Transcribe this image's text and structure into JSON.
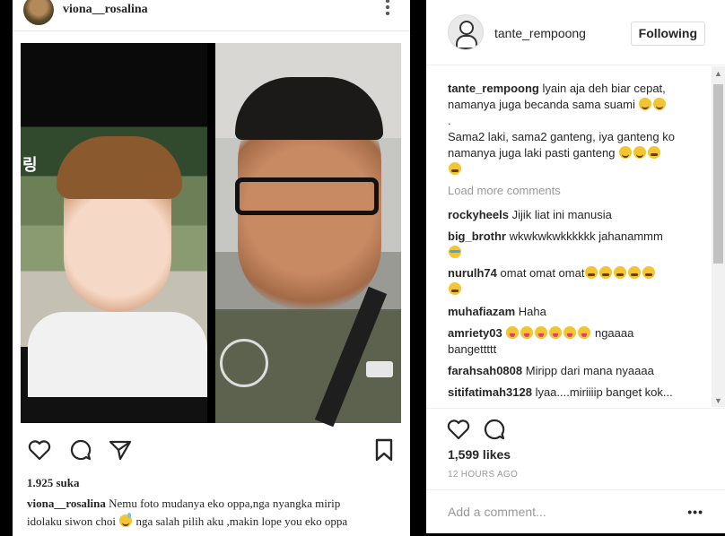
{
  "left_post": {
    "username": "viona__rosalina",
    "kebab": "⋮",
    "photo_sign_text": "링",
    "likes": "1.925 suka",
    "caption_user": "viona__rosalina",
    "caption_text_1": "Nemu foto mudanya eko oppa,nga nyangka mirip",
    "caption_text_2": "idolaku siwon choi",
    "caption_text_3": "nga salah pilih aku ,makin lope you eko oppa"
  },
  "right_panel": {
    "username": "tante_rempoong",
    "following_label": "Following",
    "comment_main_user": "tante_rempoong",
    "comment_main_text_1": "lyain aja deh biar cepat,",
    "comment_main_text_2": "namanya juga becanda sama suami",
    "comment_main_dot": ".",
    "comment_main_text_3": "Sama2 laki, sama2 ganteng, iya ganteng ko",
    "comment_main_text_4": "namanya juga laki pasti ganteng",
    "load_more": "Load more comments",
    "comments": [
      {
        "user": "rockyheels",
        "text": "Jijik liat ini manusia"
      },
      {
        "user": "big_brothr",
        "text": "wkwkwkwkkkkkk jahanammm"
      },
      {
        "user": "nurulh74",
        "text": "omat omat omat"
      },
      {
        "user": "muhafiazam",
        "text": "Haha"
      },
      {
        "user": "amriety03",
        "text": "ngaaaa",
        "text2": "bangettttt"
      },
      {
        "user": "farahsah0808",
        "text": "Miripp dari mana nyaaaa"
      },
      {
        "user": "sitifatimah3128",
        "text": "lyaa....miriiiip banget kok..."
      }
    ],
    "likes": "1,599 likes",
    "time": "12 HOURS AGO",
    "add_comment_placeholder": "Add a comment...",
    "more_dots": "•••"
  },
  "icons": [
    "heart-icon",
    "comment-icon",
    "share-icon",
    "bookmark-icon",
    "kebab-icon"
  ],
  "colors": {
    "text": "#262626",
    "muted": "#999999",
    "border": "#dbdbdb",
    "emoji": "#f3c530"
  }
}
